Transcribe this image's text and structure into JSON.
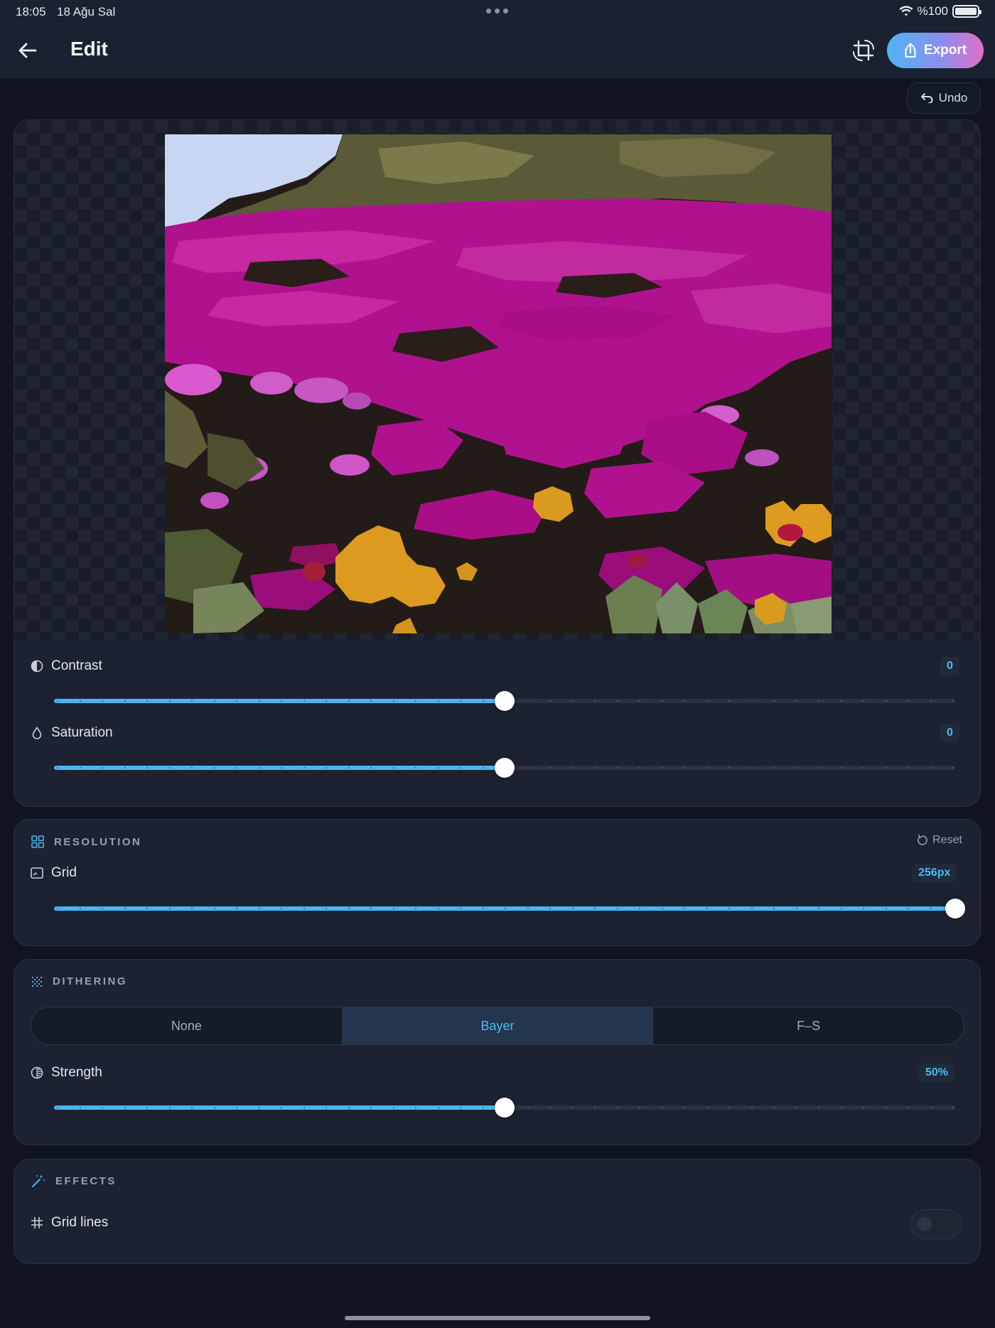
{
  "status_bar": {
    "time": "18:05",
    "date": "18 Ağu Sal",
    "battery": "%100"
  },
  "header": {
    "title": "Edit",
    "export_label": "Export",
    "undo_label": "Undo"
  },
  "canvas": {
    "image_description_icon": "pixelated-flower-image"
  },
  "adjust": {
    "contrast": {
      "label": "Contrast",
      "value": "0",
      "level": 0.5
    },
    "saturation": {
      "label": "Saturation",
      "value": "0",
      "level": 0.5
    }
  },
  "resolution": {
    "title": "RESOLUTION",
    "reset_label": "Reset",
    "grid": {
      "label": "Grid",
      "value": "256px",
      "level": 1.0
    }
  },
  "dithering": {
    "title": "DITHERING",
    "options": [
      "None",
      "Bayer",
      "F–S"
    ],
    "selected": "Bayer",
    "strength": {
      "label": "Strength",
      "value": "50%",
      "level": 0.5
    }
  },
  "effects": {
    "title": "EFFECTS",
    "grid_lines": {
      "label": "Grid lines",
      "enabled": false
    }
  },
  "colors": {
    "accent": "#49b6ef",
    "background": "#111521",
    "panel": "#1c2232",
    "export_gradient_start": "#4fb4f3",
    "export_gradient_end": "#e06fc8"
  }
}
